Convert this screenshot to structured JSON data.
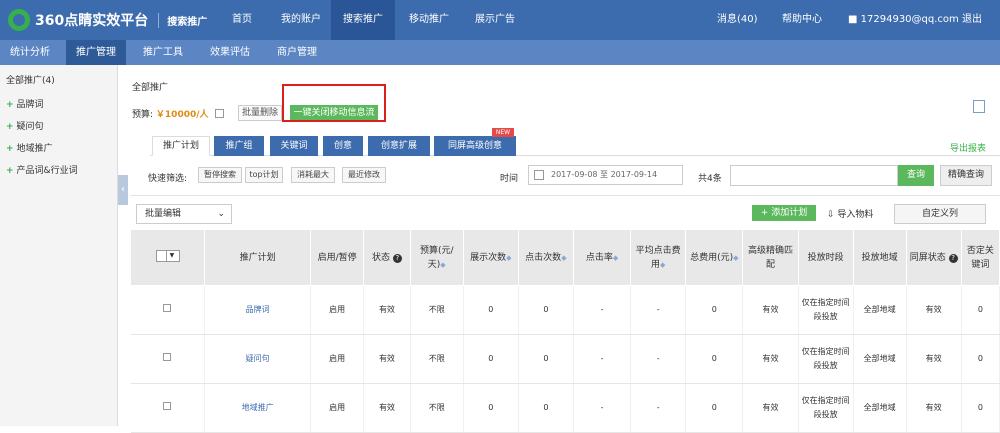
{
  "header": {
    "logo_text": "360点睛实效平台",
    "logo_sub": "搜索推广",
    "nav": [
      "首页",
      "我的账户",
      "搜索推广",
      "移动推广",
      "展示广告"
    ],
    "messages": "消息(40)",
    "help": "帮助中心",
    "user": "17294930@qq.com",
    "logout": "退出"
  },
  "subnav": [
    "统计分析",
    "推广管理",
    "推广工具",
    "效果评估",
    "商户管理"
  ],
  "sidebar": {
    "title": "全部推广(4)",
    "items": [
      "品牌词",
      "疑问句",
      "地域推广",
      "产品词&行业词"
    ]
  },
  "main": {
    "breadcrumb": "全部推广",
    "budget_label": "预算:",
    "budget_value": "￥10000/人",
    "delete_btn": "批量删除",
    "green_btn": "一键关闭移动信息流",
    "tabs": [
      "推广计划",
      "推广组",
      "关键词",
      "创意",
      "创意扩展",
      "同屏高级创意"
    ],
    "new_badge": "NEW",
    "export": "导出报表",
    "filter_label": "快速筛选:",
    "chips": [
      "暂停搜索",
      "top计划",
      "消耗最大",
      "最近修改"
    ],
    "date_label": "时间",
    "date_range": "2017-09-08 至 2017-09-14",
    "total": "共4条",
    "search_btn": "查询",
    "precise_btn": "精确查询",
    "bulk_edit": "批量编辑",
    "add_plan": "添加计划",
    "import": "导入物料",
    "custom_cols": "自定义列"
  },
  "table": {
    "headers": [
      "",
      "推广计划",
      "启用/暂停",
      "状态",
      "预算(元/天)",
      "展示次数",
      "点击次数",
      "点击率",
      "平均点击费用",
      "总费用(元)",
      "高级精确匹配",
      "投放时段",
      "投放地域",
      "同屏状态",
      "否定关键词"
    ],
    "rows": [
      [
        "",
        "品牌词",
        "启用",
        "有效",
        "不限",
        "0",
        "0",
        "-",
        "-",
        "0",
        "有效",
        "仅在指定时间段投放",
        "全部地域",
        "有效",
        "0"
      ],
      [
        "",
        "疑问句",
        "启用",
        "有效",
        "不限",
        "0",
        "0",
        "-",
        "-",
        "0",
        "有效",
        "仅在指定时间段投放",
        "全部地域",
        "有效",
        "0"
      ],
      [
        "",
        "地域推广",
        "启用",
        "有效",
        "不限",
        "0",
        "0",
        "-",
        "-",
        "0",
        "有效",
        "仅在指定时间段投放",
        "全部地域",
        "有效",
        "0"
      ]
    ]
  },
  "colors": {
    "topbar": "#3d6cae",
    "accent_green": "#5cb85c",
    "highlight_red": "#d9211b"
  }
}
